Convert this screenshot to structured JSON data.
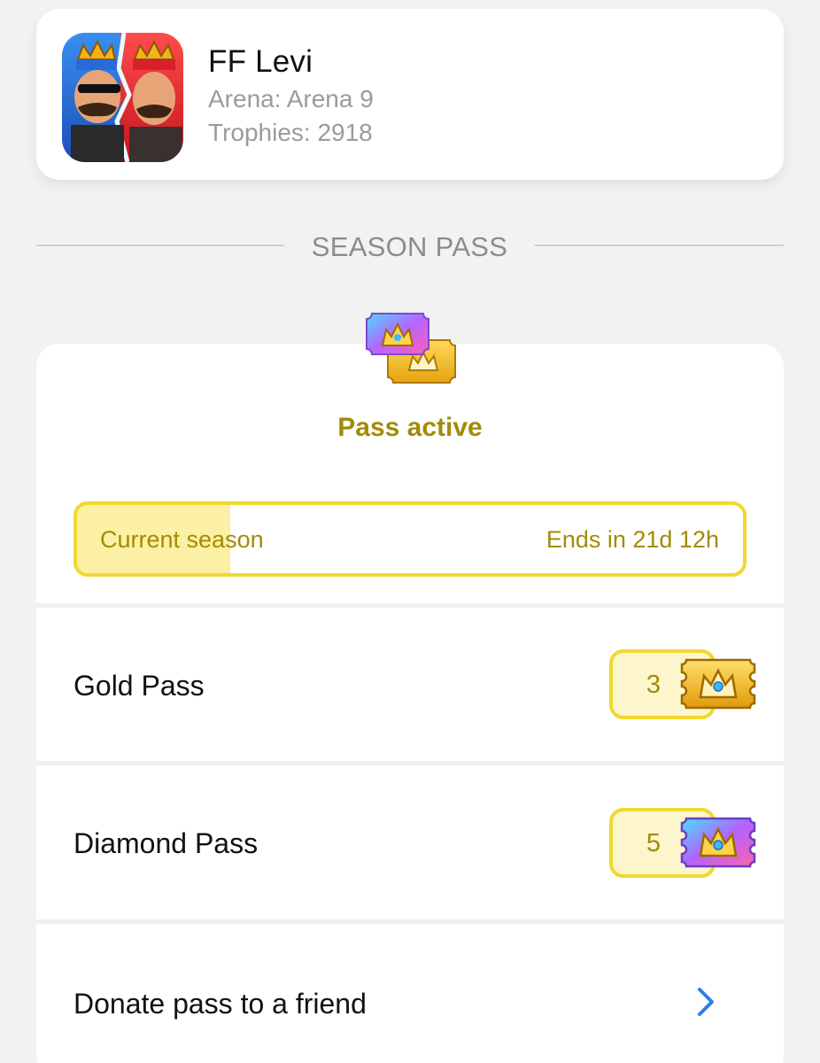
{
  "profile": {
    "name": "FF Levi",
    "arena": "Arena: Arena 9",
    "trophies": "Trophies: 2918",
    "avatar_icon": "king-avatar-icon"
  },
  "section": {
    "title": "SEASON PASS"
  },
  "pass": {
    "status": "Pass active",
    "icon": "season-pass-tickets-icon",
    "season": {
      "label": "Current season",
      "ends": "Ends in 21d 12h",
      "progress": 0.23
    },
    "rows": [
      {
        "label": "Gold Pass",
        "count": "3",
        "icon": "gold-ticket-icon"
      },
      {
        "label": "Diamond Pass",
        "count": "5",
        "icon": "diamond-ticket-icon"
      }
    ],
    "donate_label": "Donate pass to a friend",
    "donate_icon": "chevron-right-icon"
  },
  "colors": {
    "accent_gold": "#a38b06",
    "bar_border": "#f2d82e",
    "bar_fill": "#fbf0a3",
    "link_blue": "#2f7fe6"
  }
}
